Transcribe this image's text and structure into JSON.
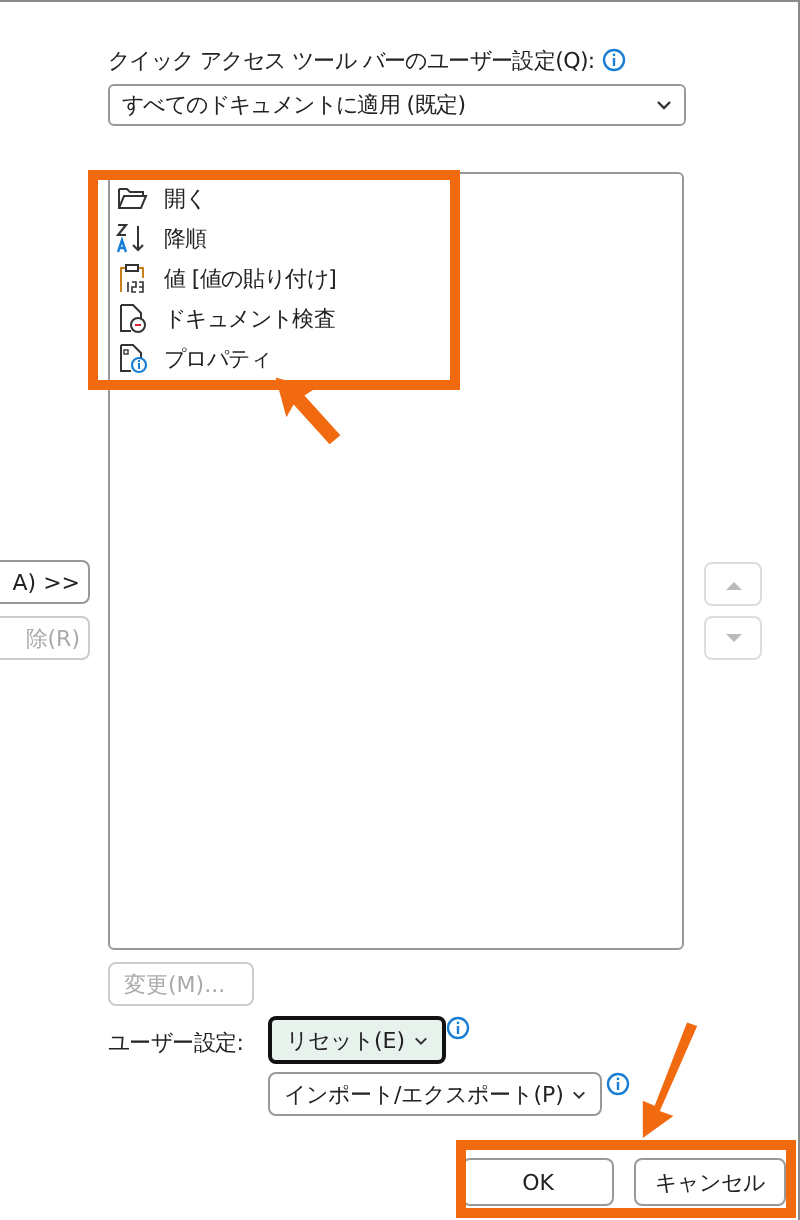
{
  "customize_label": "クイック アクセス ツール バーのユーザー設定(Q):",
  "scope_dropdown": {
    "value": "すべてのドキュメントに適用 (既定)"
  },
  "commands": [
    {
      "kind": "open",
      "label": "開く"
    },
    {
      "kind": "sort",
      "label": "降順"
    },
    {
      "kind": "paste",
      "label": "値 [値の貼り付け]"
    },
    {
      "kind": "inspect",
      "label": "ドキュメント検査"
    },
    {
      "kind": "properties",
      "label": "プロパティ"
    }
  ],
  "side_buttons": [
    {
      "label": "A) >>",
      "disabled": false
    },
    {
      "label": "除(R)",
      "disabled": true
    }
  ],
  "move_buttons": [
    {
      "kind": "up",
      "disabled": true
    },
    {
      "kind": "down",
      "disabled": true
    }
  ],
  "modify_button": {
    "label": "変更(M)...",
    "disabled": true
  },
  "customizations_label": "ユーザー設定:",
  "reset_button": {
    "label": "リセット(E)",
    "focused": true
  },
  "import_export_button": {
    "label": "インポート/エクスポート(P)"
  },
  "footer_buttons": [
    "OK",
    "キャンセル"
  ]
}
